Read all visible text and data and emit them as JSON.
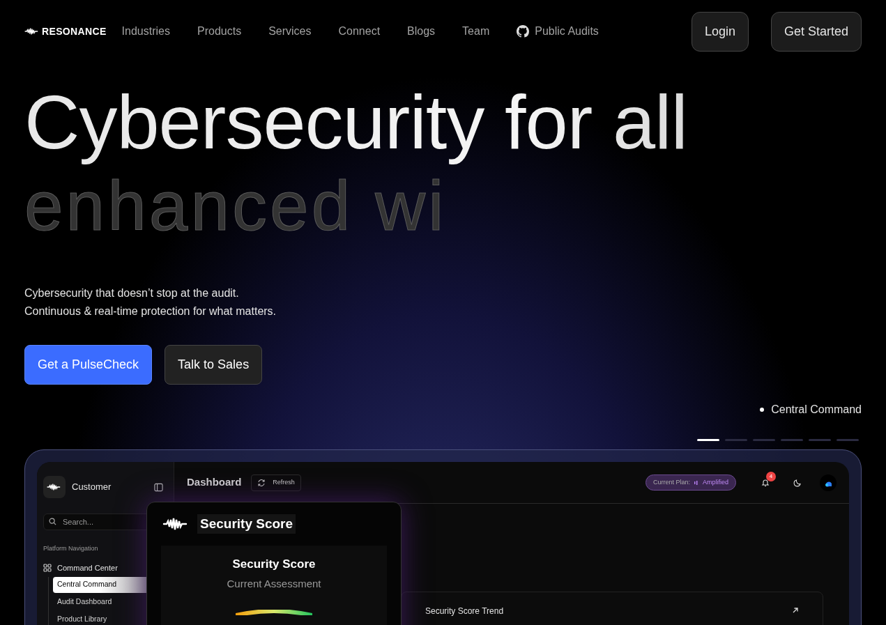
{
  "nav": {
    "brand": "RESONANCE",
    "links": [
      {
        "label": "Industries",
        "kind": "text"
      },
      {
        "label": "Products",
        "kind": "text"
      },
      {
        "label": "Services",
        "kind": "text"
      },
      {
        "label": "Connect",
        "kind": "text"
      },
      {
        "label": "Blogs",
        "kind": "text"
      },
      {
        "label": "Team",
        "kind": "text"
      },
      {
        "label": "Public Audits",
        "kind": "github"
      }
    ],
    "buttons": [
      "Login",
      "Get Started"
    ]
  },
  "hero": {
    "headline": "Cybersecurity for all",
    "headline_2": "enhanced wi",
    "lines": [
      "Cybersecurity that doesn’t stop at the audit.",
      "Continuous & real-time protection for what matters."
    ],
    "buttons": [
      {
        "label": "Get a PulseCheck",
        "kind": "primary"
      },
      {
        "label": "Talk to Sales",
        "kind": "secondary"
      }
    ]
  },
  "carousel": {
    "caption": "Central Command",
    "slides": [
      {
        "selected": true
      },
      {
        "selected": false
      },
      {
        "selected": false
      },
      {
        "selected": false
      },
      {
        "selected": false
      },
      {
        "selected": false
      }
    ]
  },
  "dashboard": {
    "workspace": "Customer",
    "search": {
      "placeholder": "Search..."
    },
    "nav_heading": "Platform Navigation",
    "nav": [
      {
        "label": "Command Center",
        "children": [
          {
            "label": "Central Command",
            "selected": true
          },
          {
            "label": "Audit Dashboard",
            "selected": false
          },
          {
            "label": "Product Library",
            "selected": false
          }
        ]
      }
    ],
    "title": "Dashboard",
    "refresh": "Refresh",
    "plan_label": "Current Plan:",
    "plan": "Amplified",
    "notifications": "4",
    "popup": {
      "title": "Security Score",
      "card_title": "Security Score",
      "card_subtitle": "Current Assessment"
    },
    "trend_title": "Security Score Trend"
  }
}
